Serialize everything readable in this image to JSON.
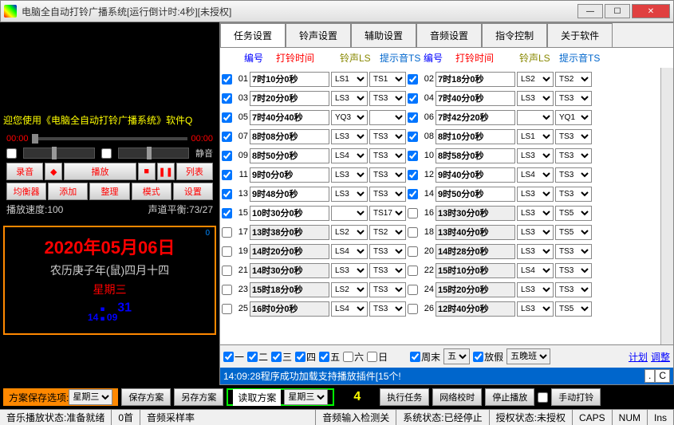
{
  "title": "电脑全自动打铃广播系统[运行倒计时:4秒][未授权]",
  "marquee": "迎您使用《电脑全自动打铃广播系统》软件Q",
  "player": {
    "t0": "00:00",
    "t1": "00:00",
    "mute": "静音",
    "rec": "录音",
    "play": "播放",
    "list": "列表",
    "eq": "均衡器",
    "add": "添加",
    "org": "整理",
    "mode": "模式",
    "set": "设置",
    "speed": "播放速度:100",
    "balance": "声道平衡:73/27"
  },
  "clock": {
    "sup": "0",
    "date": "2020年05月06日",
    "lunar": "农历庚子年(鼠)四月十四",
    "wd": "星期三",
    "hh": "14",
    "mm": "09",
    "ss": "31"
  },
  "tabs": [
    "任务设置",
    "铃声设置",
    "辅助设置",
    "音频设置",
    "指令控制",
    "关于软件"
  ],
  "hdr": {
    "c1": "编号",
    "c2": "打铃时间",
    "c3": "铃声LS",
    "c4": "提示音TS"
  },
  "rows": [
    {
      "n": "01",
      "on": true,
      "t": "7时10分0秒",
      "ls": "LS1",
      "ts": "TS1"
    },
    {
      "n": "02",
      "on": true,
      "t": "7时18分0秒",
      "ls": "LS2",
      "ts": "TS2"
    },
    {
      "n": "03",
      "on": true,
      "t": "7时20分0秒",
      "ls": "LS3",
      "ts": "TS3"
    },
    {
      "n": "04",
      "on": true,
      "t": "7时40分0秒",
      "ls": "LS3",
      "ts": "TS3"
    },
    {
      "n": "05",
      "on": true,
      "t": "7时40分40秒",
      "ls": "YQ3",
      "ts": ""
    },
    {
      "n": "06",
      "on": true,
      "t": "7时42分20秒",
      "ls": "",
      "ts": "YQ1"
    },
    {
      "n": "07",
      "on": true,
      "t": "8时08分0秒",
      "ls": "LS3",
      "ts": "TS3"
    },
    {
      "n": "08",
      "on": true,
      "t": "8时10分0秒",
      "ls": "LS1",
      "ts": "TS3"
    },
    {
      "n": "09",
      "on": true,
      "t": "8时50分0秒",
      "ls": "LS4",
      "ts": "TS3"
    },
    {
      "n": "10",
      "on": true,
      "t": "8时58分0秒",
      "ls": "LS3",
      "ts": "TS3"
    },
    {
      "n": "11",
      "on": true,
      "t": "9时0分0秒",
      "ls": "LS3",
      "ts": "TS3"
    },
    {
      "n": "12",
      "on": true,
      "t": "9时40分0秒",
      "ls": "LS4",
      "ts": "TS3"
    },
    {
      "n": "13",
      "on": true,
      "t": "9时48分0秒",
      "ls": "LS3",
      "ts": "TS3"
    },
    {
      "n": "14",
      "on": true,
      "t": "9时50分0秒",
      "ls": "LS3",
      "ts": "TS3"
    },
    {
      "n": "15",
      "on": true,
      "t": "10时30分0秒",
      "ls": "",
      "ts": "TS17"
    },
    {
      "n": "16",
      "on": false,
      "t": "13时30分0秒",
      "ls": "LS3",
      "ts": "TS5"
    },
    {
      "n": "17",
      "on": false,
      "t": "13时38分0秒",
      "ls": "LS2",
      "ts": "TS2"
    },
    {
      "n": "18",
      "on": false,
      "t": "13时40分0秒",
      "ls": "LS3",
      "ts": "TS5"
    },
    {
      "n": "19",
      "on": false,
      "t": "14时20分0秒",
      "ls": "LS4",
      "ts": "TS3"
    },
    {
      "n": "20",
      "on": false,
      "t": "14时28分0秒",
      "ls": "LS3",
      "ts": "TS3"
    },
    {
      "n": "21",
      "on": false,
      "t": "14时30分0秒",
      "ls": "LS3",
      "ts": "TS3"
    },
    {
      "n": "22",
      "on": false,
      "t": "15时10分0秒",
      "ls": "LS4",
      "ts": "TS3"
    },
    {
      "n": "23",
      "on": false,
      "t": "15时18分0秒",
      "ls": "LS2",
      "ts": "TS3"
    },
    {
      "n": "24",
      "on": false,
      "t": "15时20分0秒",
      "ls": "LS3",
      "ts": "TS3"
    },
    {
      "n": "25",
      "on": false,
      "t": "16时0分0秒",
      "ls": "LS4",
      "ts": "TS3"
    },
    {
      "n": "26",
      "on": false,
      "t": "12时40分0秒",
      "ls": "LS3",
      "ts": "TS5"
    }
  ],
  "days": {
    "d1": "一",
    "d2": "二",
    "d3": "三",
    "d4": "四",
    "d5": "五",
    "d6": "六",
    "d7": "日",
    "week": "周末",
    "weeksel": "五",
    "holiday": "放假",
    "shift": "五晚班",
    "plan": "计划",
    "adj": "调整"
  },
  "statusmsg": "14:09:28程序成功加载支持播放插件[15个!",
  "bottom": {
    "savelbl": "方案保存选项:",
    "savesel": "星期三",
    "save": "保存方案",
    "saveas": "另存方案",
    "read": "读取方案",
    "readsel": "星期三",
    "num": "4",
    "exec": "执行任务",
    "sync": "网络校时",
    "stop": "停止播放",
    "manual": "手动打铃"
  },
  "status": {
    "s1": "音乐播放状态:准备就绪",
    "s2": "0首",
    "s3": "音频采样率",
    "s4": "音频输入检测关",
    "s5": "系统状态:已经停止",
    "s6": "授权状态:未授权",
    "caps": "CAPS",
    "num": "NUM",
    "ins": "Ins"
  }
}
